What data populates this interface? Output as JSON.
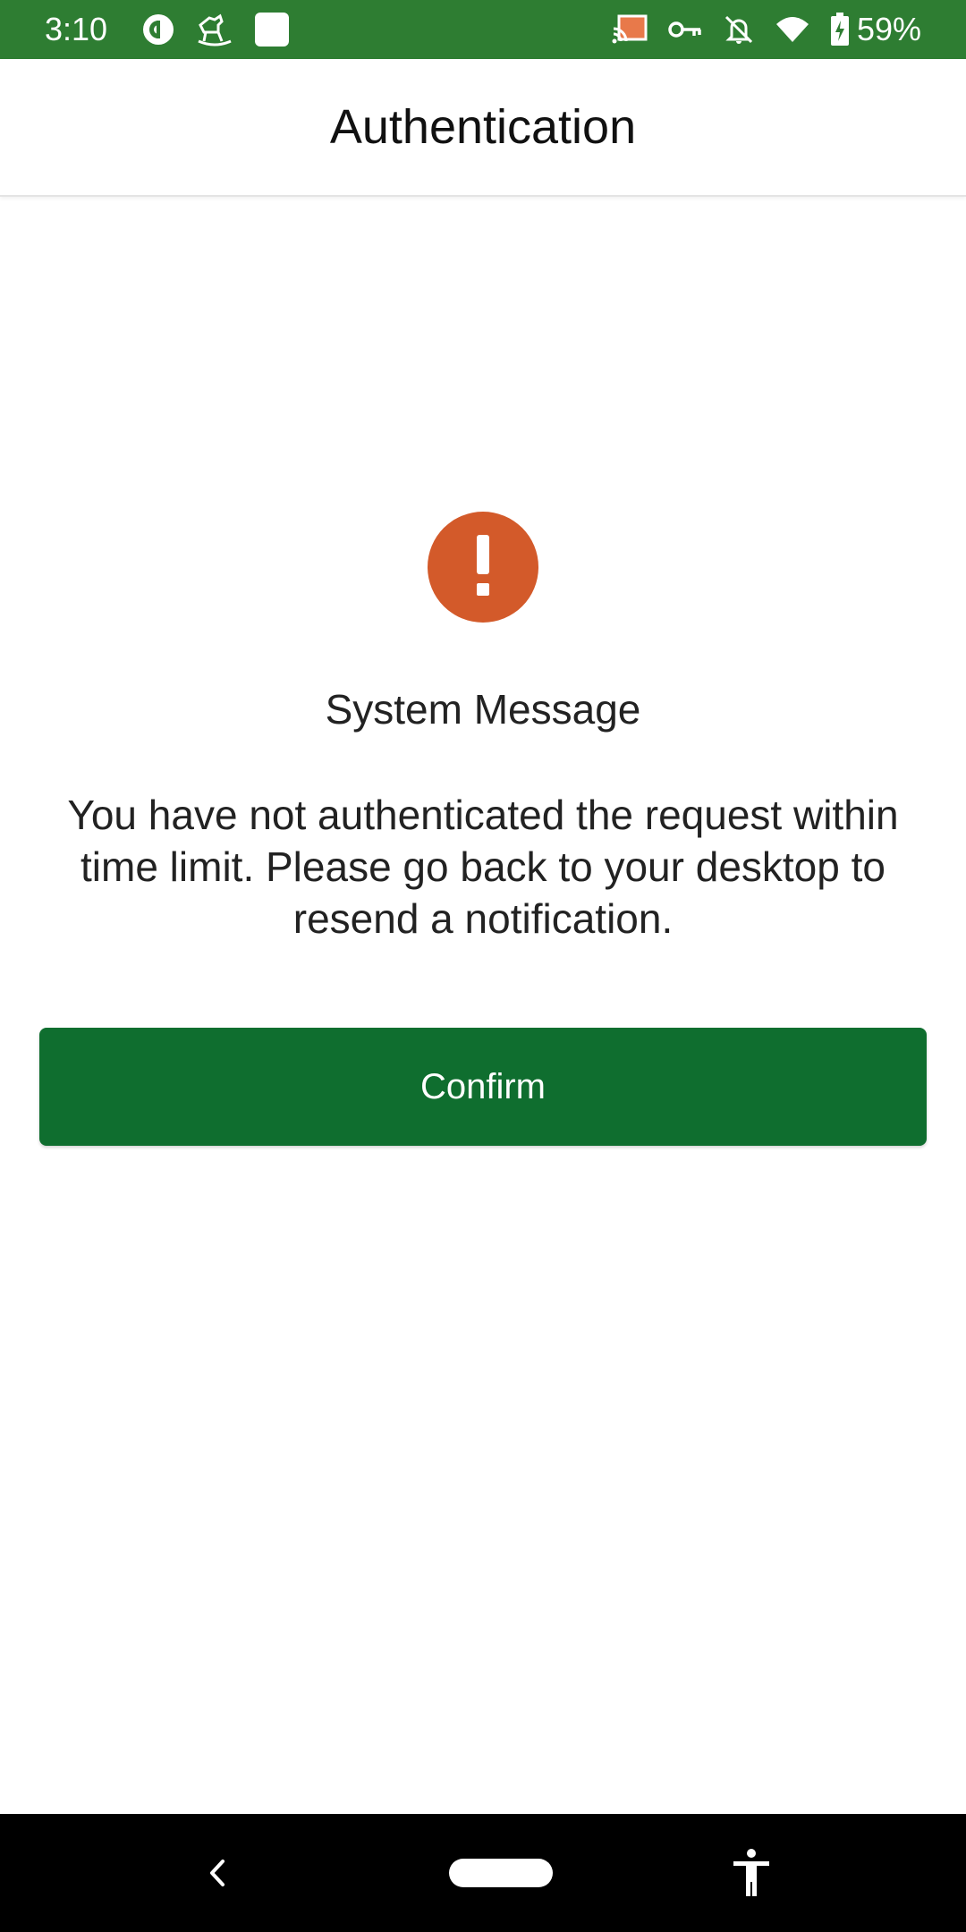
{
  "status_bar": {
    "time": "3:10",
    "battery_percent": "59%",
    "left_icons": [
      "pocketcasts-icon",
      "rocking-horse-icon",
      "square-app-icon"
    ],
    "right_icons": [
      "cast-icon",
      "vpn-key-icon",
      "notifications-off-icon",
      "wifi-icon",
      "battery-charging-icon"
    ],
    "background_color": "#2e7d32"
  },
  "app_bar": {
    "title": "Authentication"
  },
  "alert": {
    "icon": "exclamation-icon",
    "glyph": "!",
    "color": "#d35a2a"
  },
  "message": {
    "title": "System Message",
    "body": "You have not authenticated the request within time limit. Please go back to your desktop to resend a notification."
  },
  "confirm_button": {
    "label": "Confirm",
    "color": "#0f6e2f"
  },
  "nav_bar": {
    "back_icon": "back-chevron-icon",
    "home_icon": "home-pill-icon",
    "accessibility_icon": "accessibility-icon"
  }
}
